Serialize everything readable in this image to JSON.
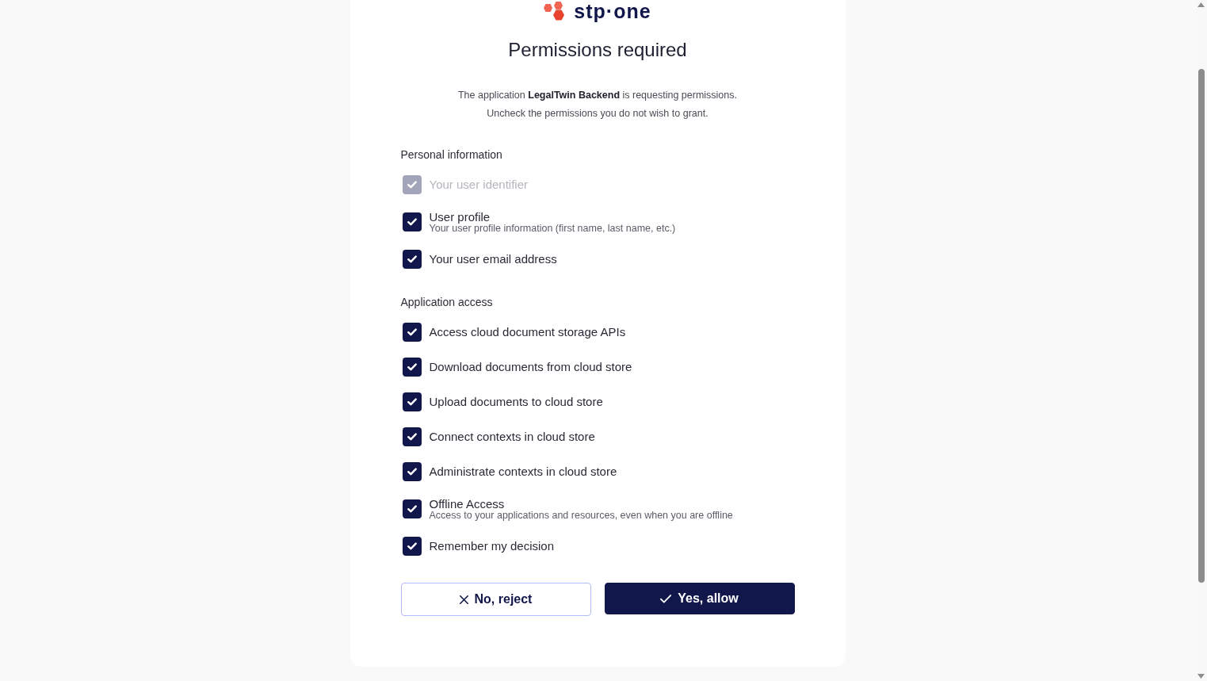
{
  "logo": {
    "wordmark": "stp·one"
  },
  "title": "Permissions required",
  "intro": [
    "The application **LegalTwin Backend** is requesting permissions.",
    "Uncheck the permissions you do not wish to grant."
  ],
  "sections": [
    {
      "heading": "Personal information",
      "items": [
        {
          "label": "Your user identifier",
          "checked": true,
          "disabled": true
        },
        {
          "label": "User profile",
          "description": "Your user profile information (first name, last name, etc.)",
          "checked": true,
          "disabled": false
        },
        {
          "label": "Your user email address",
          "checked": true,
          "disabled": false
        }
      ]
    },
    {
      "heading": "Application access",
      "items": [
        {
          "label": "Access cloud document storage APIs",
          "checked": true,
          "disabled": false
        },
        {
          "label": "Download documents from cloud store",
          "checked": true,
          "disabled": false
        },
        {
          "label": "Upload documents to cloud store",
          "checked": true,
          "disabled": false
        },
        {
          "label": "Connect contexts in cloud store",
          "checked": true,
          "disabled": false
        },
        {
          "label": "Administrate contexts in cloud store",
          "checked": true,
          "disabled": false
        },
        {
          "label": "Offline Access",
          "description": "Access to your applications and resources, even when you are offline",
          "checked": true,
          "disabled": false
        }
      ]
    }
  ],
  "remember": {
    "label": "Remember my decision",
    "checked": true,
    "disabled": false
  },
  "buttons": [
    {
      "kind": "reject",
      "label": "No, reject"
    },
    {
      "kind": "allow",
      "label": "Yes, allow"
    }
  ]
}
